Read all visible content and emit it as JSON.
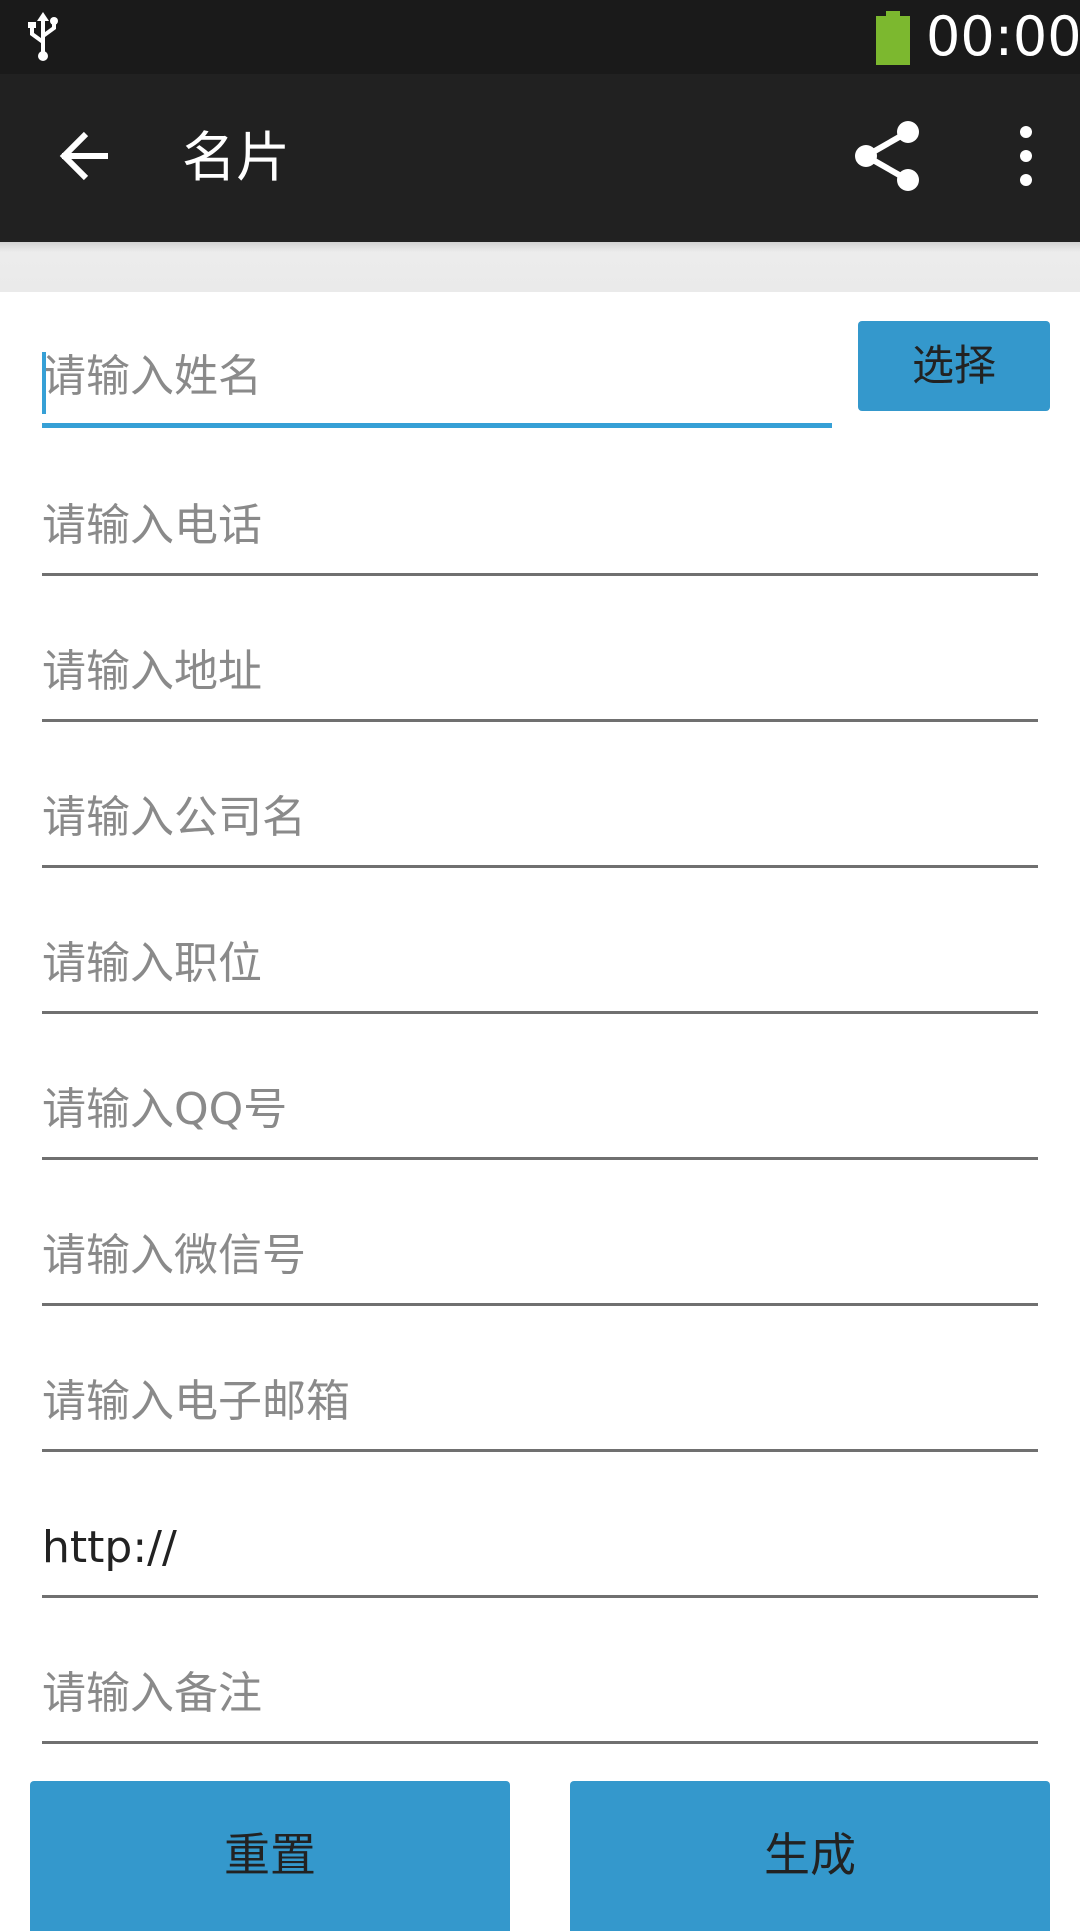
{
  "status_bar": {
    "time": "00:00",
    "battery_color": "#7cb82f",
    "usb_icon": "usb-icon",
    "battery_icon": "battery-icon"
  },
  "toolbar": {
    "title": "名片",
    "back_icon": "arrow-left-icon",
    "share_icon": "share-icon",
    "more_icon": "more-vert-icon"
  },
  "form": {
    "name": {
      "placeholder": "请输入姓名",
      "value": ""
    },
    "select_label": "选择",
    "phone": {
      "placeholder": "请输入电话",
      "value": ""
    },
    "address": {
      "placeholder": "请输入地址",
      "value": ""
    },
    "company": {
      "placeholder": "请输入公司名",
      "value": ""
    },
    "position": {
      "placeholder": "请输入职位",
      "value": ""
    },
    "qq": {
      "placeholder": "请输入QQ号",
      "value": ""
    },
    "wechat": {
      "placeholder": "请输入微信号",
      "value": ""
    },
    "email": {
      "placeholder": "请输入电子邮箱",
      "value": ""
    },
    "website": {
      "placeholder": "",
      "value": "http://"
    },
    "notes": {
      "placeholder": "请输入备注",
      "value": ""
    }
  },
  "buttons": {
    "reset": "重置",
    "generate": "生成"
  },
  "colors": {
    "accent": "#36a0d6",
    "button": "#3498cc",
    "toolbar": "#212121",
    "status_bar": "#1a1a1a"
  }
}
